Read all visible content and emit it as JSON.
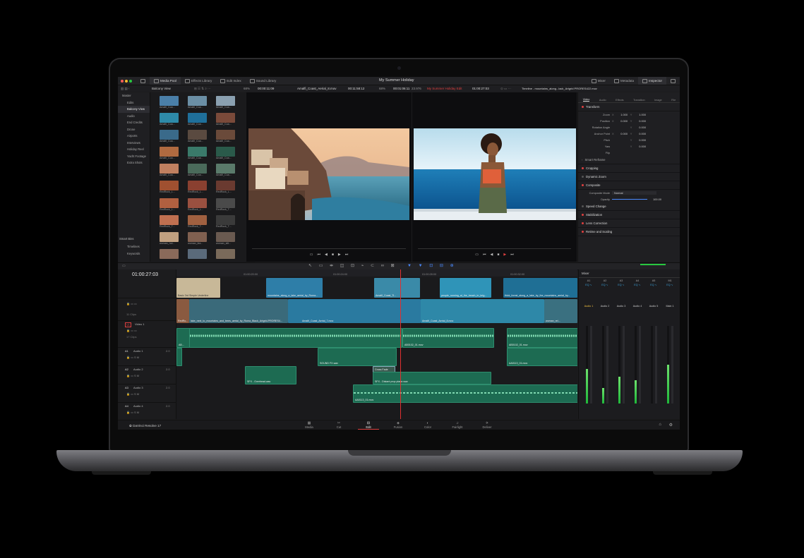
{
  "app": {
    "project_title": "My Summer Holiday",
    "brand": "DaVinci Resolve 17"
  },
  "topbar": {
    "left_items": [
      "Media Pool",
      "Effects Library",
      "Edit Index",
      "Sound Library"
    ],
    "right_items": [
      "Mixer",
      "Metadata",
      "Inspector"
    ]
  },
  "source_viewer": {
    "zoom": "68%",
    "timecode_left": "00:00:11:09",
    "clip_name": "Amalfi_Coast_Aerial_8.mov",
    "timecode_right": "00:11:58:12"
  },
  "timeline_viewer": {
    "zoom": "68%",
    "timecode_left": "00:01:06:11",
    "fps": "23.976",
    "timeline_name": "My Summer Holiday Edit",
    "timecode_right": "01:00:27:03"
  },
  "bins": {
    "current": "Balcony View",
    "master": "Master",
    "items": [
      "Edits",
      "Balcony View",
      "Audio",
      "End Credits",
      "Drone",
      "Airports",
      "Interviews",
      "Holiday Reel",
      "Yacht Footage",
      "Extra Shots"
    ],
    "smart_bins_header": "Smart Bins",
    "smart_items": [
      "Timelines",
      "Keywords"
    ]
  },
  "thumbnails": [
    {
      "label": "Amalfi_Coa...",
      "color": "#4a7fa8"
    },
    {
      "label": "Amalfi_Coa...",
      "color": "#6b8fa5"
    },
    {
      "label": "Amalfi_Coa...",
      "color": "#8aa0b0"
    },
    {
      "label": "Amalfi_Coa...",
      "color": "#2e8aa8"
    },
    {
      "label": "Amalfi_Coa...",
      "color": "#1f6f9a"
    },
    {
      "label": "Amalfi_Coa...",
      "color": "#7a4a3a"
    },
    {
      "label": "Amalfi_Coa...",
      "color": "#3a6a8a"
    },
    {
      "label": "Amalfi_Coa...",
      "color": "#5a4a40"
    },
    {
      "label": "Amalfi_Coa...",
      "color": "#6a4a3a"
    },
    {
      "label": "Amalfi_Coa...",
      "color": "#b06a40"
    },
    {
      "label": "Amalfi_Coa...",
      "color": "#3a7a6a"
    },
    {
      "label": "Amalfi_Coa...",
      "color": "#2a5a4a"
    },
    {
      "label": "Amalfi_Coa...",
      "color": "#c08060"
    },
    {
      "label": "Amalfi_Coa...",
      "color": "#4a6a5a"
    },
    {
      "label": "Amalfi_Coa...",
      "color": "#5a7a6a"
    },
    {
      "label": "RedRock_L...",
      "color": "#a05030"
    },
    {
      "label": "RedRock_L...",
      "color": "#8a4030"
    },
    {
      "label": "RedRock_L...",
      "color": "#6a3a30"
    },
    {
      "label": "RedRock_L...",
      "color": "#b06040"
    },
    {
      "label": "RedRock_L...",
      "color": "#9a5040"
    },
    {
      "label": "RedRock_T...",
      "color": "#4a4a4a"
    },
    {
      "label": "RedRock_T...",
      "color": "#c07050"
    },
    {
      "label": "RedRock_T...",
      "color": "#a06040"
    },
    {
      "label": "RedRock_T...",
      "color": "#3a3a3a"
    },
    {
      "label": "woman_hol...",
      "color": "#c0a080"
    },
    {
      "label": "woman_lea...",
      "color": "#806050"
    },
    {
      "label": "woman_sitt...",
      "color": "#6a5a50"
    },
    {
      "label": "",
      "color": "#8a6a5a"
    },
    {
      "label": "",
      "color": "#5a6a7a"
    },
    {
      "label": "",
      "color": "#7a6a5a"
    }
  ],
  "inspector": {
    "title": "Timeline - mountains_along...lack_Artgrid PRORES422.mov",
    "tabs": [
      "Video",
      "Audio",
      "Effects",
      "Transition",
      "Image",
      "File"
    ],
    "transform_header": "Transform",
    "params": [
      {
        "label": "Zoom",
        "x": "1.000",
        "y": "1.000"
      },
      {
        "label": "Position",
        "x": "0.000",
        "y": "0.000"
      },
      {
        "label": "Rotation Angle",
        "x": "",
        "y": "0.000"
      },
      {
        "label": "Anchor Point",
        "x": "0.000",
        "y": "0.000"
      },
      {
        "label": "Pitch",
        "x": "",
        "y": "0.000"
      },
      {
        "label": "Yaw",
        "x": "",
        "y": "0.000"
      },
      {
        "label": "Flip",
        "x": "",
        "y": ""
      }
    ],
    "sections": [
      "Smart Reframe",
      "Cropping",
      "Dynamic Zoom",
      "Composite"
    ],
    "composite_mode_label": "Composite Mode",
    "composite_mode_value": "Normal",
    "opacity_label": "Opacity",
    "opacity_value": "100.00",
    "sections2": [
      "Speed Change",
      "Stabilization",
      "Lens Correction",
      "Retime and Scaling"
    ]
  },
  "timeline": {
    "timecode": "01:00:27:03",
    "ruler_marks": [
      "01:00:20:00",
      "01:00:24:00",
      "01:00:28:00",
      "01:00:32:00"
    ],
    "tracks": [
      {
        "id": "V2",
        "name": "",
        "clips": "11 Clips"
      },
      {
        "id": "V1",
        "name": "Video 1",
        "clips": "17 Clips"
      },
      {
        "id": "A1",
        "name": "Audio 1",
        "level": "2.0"
      },
      {
        "id": "A2",
        "name": "Audio 2",
        "level": "2.0"
      },
      {
        "id": "A3",
        "name": "Audio 3",
        "level": "2.0"
      },
      {
        "id": "A4",
        "name": "Audio 4",
        "level": "2.0"
      }
    ],
    "v2_clips": [
      "Basic 3rd Simple Underline",
      "mountains_along_a_lake_aerial_by_Roma...",
      "Amalfi_Coast_Ti...",
      "people_running_at_the_beach_in_brig...",
      "thick_forest_along_a_lake_by_the_mountains_aerial_by..."
    ],
    "v1_clips": [
      "RedRo...",
      "lake_next_to_mountains_and_trees_aerial_by_Roma_Black_Artgrid-PRORES4...",
      "Amalfi_Coast_Aerial_7.mov",
      "Amalfi_Coast_Aerial_8.mov",
      "woman_rel..."
    ],
    "a1_clips": [
      "AB...",
      "AB0102_01.mov",
      "AB0102_01.mov"
    ],
    "a2_clips": [
      "SOUND FX.wav",
      "AA0113_01.mov"
    ],
    "a3_clips": [
      "SFX - Overhead.wav",
      "Cross Fade",
      "SFX - Distant prop plane.wav"
    ],
    "a4_clips": [
      "AA0113_01.mov"
    ]
  },
  "mixer": {
    "title": "Mixer",
    "channels": [
      "A1",
      "A2",
      "A3",
      "A4",
      "A5",
      "M1"
    ],
    "strips": [
      "Audio 1",
      "Audio 2",
      "Audio 3",
      "Audio 4",
      "Audio 5",
      "Main 1"
    ],
    "meter_levels": [
      0.45,
      0.2,
      0.35,
      0.3,
      0.0,
      0.5
    ]
  },
  "pages": [
    "Media",
    "Cut",
    "Edit",
    "Fusion",
    "Color",
    "Fairlight",
    "Deliver"
  ],
  "active_page": "Edit",
  "colors": {
    "accent_red": "#e04040",
    "audio_clip": "#1d6b52",
    "video_clip": "#1a4f72",
    "meter_green": "#1fb83a"
  }
}
